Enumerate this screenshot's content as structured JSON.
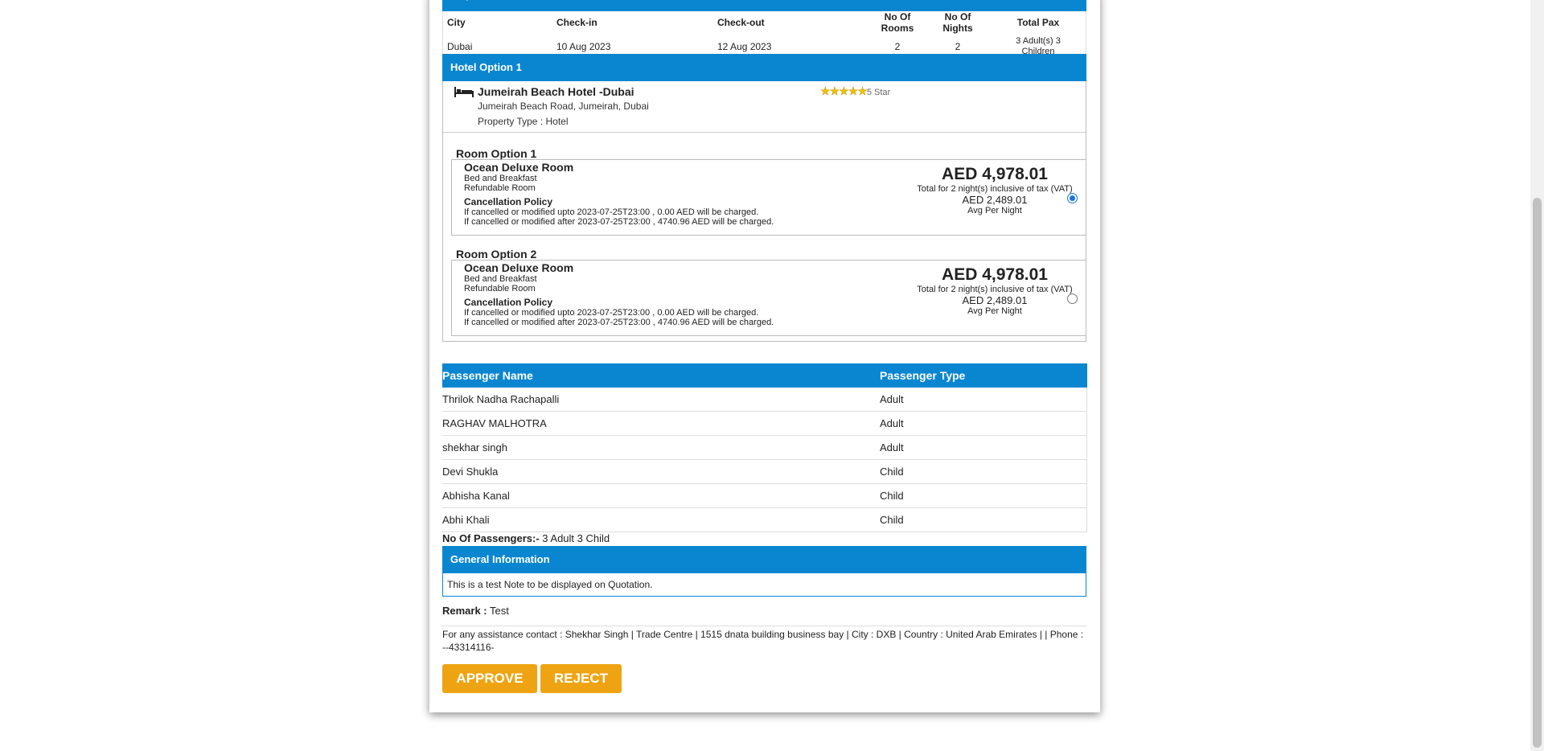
{
  "requirement": {
    "header": "Requirement",
    "columns": [
      "City",
      "Check-in",
      "Check-out",
      "No Of Rooms",
      "No Of Nights",
      "Total Pax"
    ],
    "row": {
      "city": "Dubai",
      "checkin": "10 Aug 2023",
      "checkout": "12 Aug 2023",
      "rooms": "2",
      "nights": "2",
      "pax": "3 Adult(s) 3 Children"
    }
  },
  "hotel": {
    "header": "Hotel Option 1",
    "name": "Jumeirah Beach Hotel -Dubai",
    "rating_label": "5 Star",
    "stars": 5,
    "address": "Jumeirah Beach Road, Jumeirah, Dubai",
    "property_type": "Property Type : Hotel"
  },
  "rooms": [
    {
      "title": "Room Option 1",
      "name": "Ocean Deluxe Room",
      "board": "Bed and Breakfast",
      "refund": "Refundable Room",
      "policy_title": "Cancellation Policy",
      "policy_1": "If cancelled or modified upto 2023-07-25T23:00 , 0.00 AED will be charged.",
      "policy_2": "If cancelled or modified after 2023-07-25T23:00 , 4740.96 AED will be charged.",
      "total": "AED 4,978.01",
      "total_note": "Total for 2 night(s) inclusive of tax (VAT)",
      "avg": "AED 2,489.01",
      "avg_label": "Avg Per Night",
      "selected": true
    },
    {
      "title": "Room Option 2",
      "name": "Ocean Deluxe Room",
      "board": "Bed and Breakfast",
      "refund": "Refundable Room",
      "policy_title": "Cancellation Policy",
      "policy_1": "If cancelled or modified upto 2023-07-25T23:00 , 0.00 AED will be charged.",
      "policy_2": "If cancelled or modified after 2023-07-25T23:00 , 4740.96 AED will be charged.",
      "total": "AED 4,978.01",
      "total_note": "Total for 2 night(s) inclusive of tax (VAT)",
      "avg": "AED 2,489.01",
      "avg_label": "Avg Per Night",
      "selected": false
    }
  ],
  "passengers": {
    "col_name": "Passenger Name",
    "col_type": "Passenger Type",
    "rows": [
      {
        "name": "Thrilok Nadha Rachapalli",
        "type": "Adult"
      },
      {
        "name": "RAGHAV MALHOTRA",
        "type": "Adult"
      },
      {
        "name": "shekhar singh",
        "type": "Adult"
      },
      {
        "name": "Devi Shukla",
        "type": "Child"
      },
      {
        "name": "Abhisha Kanal",
        "type": "Child"
      },
      {
        "name": "Abhi Khali",
        "type": "Child"
      }
    ],
    "count_label": "No Of Passengers:-",
    "count_value": " 3 Adult 3 Child"
  },
  "general": {
    "header": "General Information",
    "note": "This is a test Note to be displayed on Quotation."
  },
  "remark": {
    "label": "Remark :",
    "value": " Test"
  },
  "assistance": "For any assistance contact : Shekhar Singh | Trade Centre | 1515 dnata building business bay | City : DXB | Country : United Arab Emirates | | Phone : --43314116-",
  "buttons": {
    "approve": "APPROVE",
    "reject": "REJECT"
  },
  "colors": {
    "header_blue": "#0a86d0",
    "button_orange": "#eea412"
  }
}
